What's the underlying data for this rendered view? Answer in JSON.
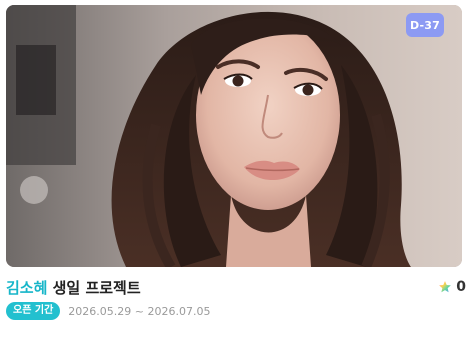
{
  "card": {
    "d_day": "D-37",
    "title_name": "김소혜",
    "title_rest": " 생일 프로젝트",
    "like_count": "0",
    "status_badge": "오픈 기간",
    "period": "2026.05.29 ~ 2026.07.05",
    "image_icon": "portrait-photo",
    "like_icon": "rainbow-star-icon",
    "colors": {
      "accent_teal": "#17b6c9",
      "badge_teal": "#22c0cf",
      "dday_bg": "#8c9af3"
    }
  }
}
